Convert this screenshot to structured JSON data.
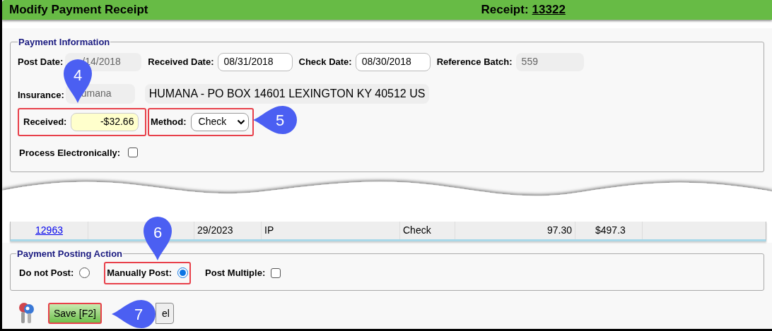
{
  "window": {
    "title": "Modify Payment Receipt",
    "receipt_label": "Receipt:",
    "receipt_number": "13322"
  },
  "payment_information": {
    "legend": "Payment Information",
    "fields": [
      {
        "label": "Post Date:",
        "value": "/14/2018",
        "disabled": true
      },
      {
        "label": "Received Date:",
        "value": "08/31/2018",
        "disabled": false
      },
      {
        "label": "Check Date:",
        "value": "08/30/2018",
        "disabled": false
      },
      {
        "label": "Reference Batch:",
        "value": "559",
        "disabled": true
      }
    ],
    "insurance": {
      "label": "Insurance:",
      "code": "umana",
      "address": "HUMANA - PO BOX 14601 LEXINGTON KY 40512 US"
    },
    "received": {
      "label": "Received:",
      "value": "-$32.66",
      "highlighted": true
    },
    "method": {
      "label": "Method:",
      "value": "Check",
      "highlighted": true
    },
    "process_electronically": {
      "label": "Process Electronically:",
      "checked": false
    }
  },
  "table_row": {
    "cells": [
      {
        "kind": "link",
        "text": "12963"
      },
      {
        "kind": "text",
        "text": "29/2023"
      },
      {
        "kind": "text",
        "text": "IP"
      },
      {
        "kind": "text",
        "text": "Check"
      },
      {
        "kind": "amount",
        "text": "97.30"
      },
      {
        "kind": "text",
        "text": "$497.3"
      }
    ]
  },
  "posting_action": {
    "legend": "Payment Posting Action",
    "options": [
      {
        "kind": "radio",
        "label": "Do not Post:",
        "selected": false,
        "highlighted": false
      },
      {
        "kind": "radio",
        "label": "Manually Post:",
        "selected": true,
        "highlighted": true
      },
      {
        "kind": "checkbox",
        "label": "Post Multiple:",
        "checked": false,
        "highlighted": false
      }
    ]
  },
  "buttons": [
    {
      "kind": "primary",
      "label": "Save [F2]",
      "highlighted": true
    },
    {
      "kind": "secondary",
      "label": "el",
      "highlighted": false
    }
  ],
  "callouts": [
    {
      "kind": "down",
      "number": "4"
    },
    {
      "kind": "left",
      "number": "5"
    },
    {
      "kind": "down",
      "number": "6"
    },
    {
      "kind": "left",
      "number": "7"
    }
  ]
}
